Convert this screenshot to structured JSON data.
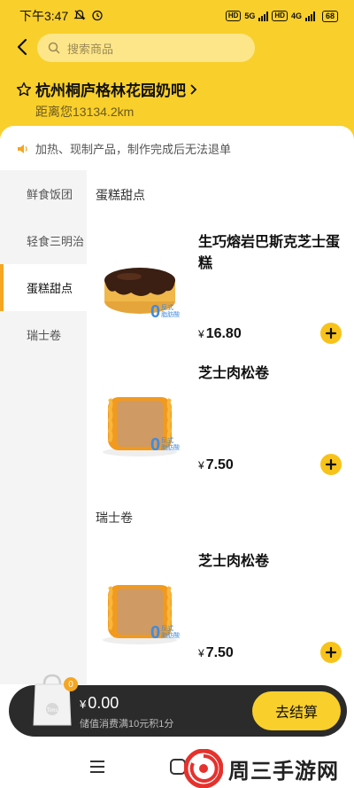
{
  "status": {
    "time": "下午3:47",
    "battery": "68",
    "net1": "5G",
    "net2": "4G",
    "hd": "HD"
  },
  "search": {
    "placeholder": "搜索商品"
  },
  "store": {
    "name": "杭州桐庐格林花园奶吧",
    "distance": "距离您13134.2km"
  },
  "notice": "加热、现制产品，制作完成后无法退单",
  "categories": [
    {
      "label": "鲜食饭团",
      "active": false
    },
    {
      "label": "轻食三明治",
      "active": false
    },
    {
      "label": "蛋糕甜点",
      "active": true
    },
    {
      "label": "瑞士卷",
      "active": false
    }
  ],
  "sections": [
    {
      "title": "蛋糕甜点"
    },
    {
      "title": "瑞士卷"
    }
  ],
  "products": [
    {
      "name": "生巧熔岩巴斯克芝士蛋糕",
      "currency": "¥",
      "price": "16.80",
      "badge_num": "0",
      "badge_l1": "反式",
      "badge_l2": "脂肪酸"
    },
    {
      "name": "芝士肉松卷",
      "currency": "¥",
      "price": "7.50",
      "badge_num": "0",
      "badge_l1": "反式",
      "badge_l2": "脂肪酸"
    },
    {
      "name": "芝士肉松卷",
      "currency": "¥",
      "price": "7.50",
      "badge_num": "0",
      "badge_l1": "反式",
      "badge_l2": "脂肪酸"
    }
  ],
  "cart": {
    "count": "0",
    "currency": "¥",
    "total": "0.00",
    "note": "储值消费满10元积1分",
    "checkout_label": "去结算",
    "bag_label": "Tims"
  },
  "watermark": {
    "text": "周三手游网"
  },
  "colors": {
    "brand_yellow": "#f9cf2b",
    "accent_orange": "#f5a623",
    "badge_blue": "#3f8be0",
    "cart_dark": "#2b2b2b"
  }
}
